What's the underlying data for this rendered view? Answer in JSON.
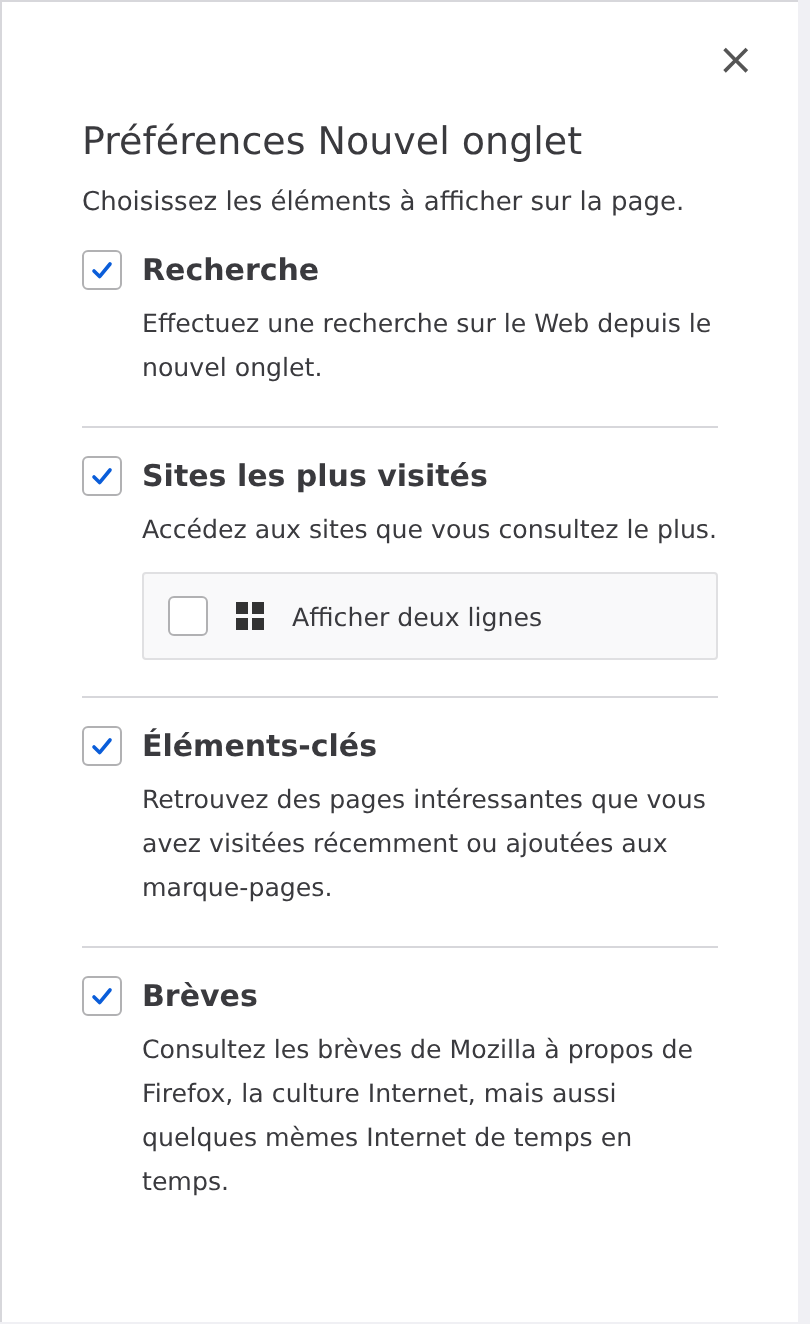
{
  "close_button": {
    "label": "×"
  },
  "title": "Préférences Nouvel onglet",
  "subtitle": "Choisissez les éléments à afficher sur la page.",
  "sections": [
    {
      "title": "Recherche",
      "checked": true,
      "description": "Effectuez une recherche sur le Web depuis le nouvel onglet."
    },
    {
      "title": "Sites les plus visités",
      "checked": true,
      "description": "Accédez aux sites que vous consultez le plus.",
      "options": [
        {
          "label": "Afficher deux lignes",
          "checked": false
        }
      ]
    },
    {
      "title": "Éléments-clés",
      "checked": true,
      "description": "Retrouvez des pages intéressantes que vous avez visitées récemment ou ajoutées aux marque-pages."
    },
    {
      "title": "Brèves",
      "checked": true,
      "description": "Consultez les brèves de Mozilla à propos de Firefox, la culture Internet, mais aussi quelques mèmes Internet de temps en temps."
    }
  ]
}
